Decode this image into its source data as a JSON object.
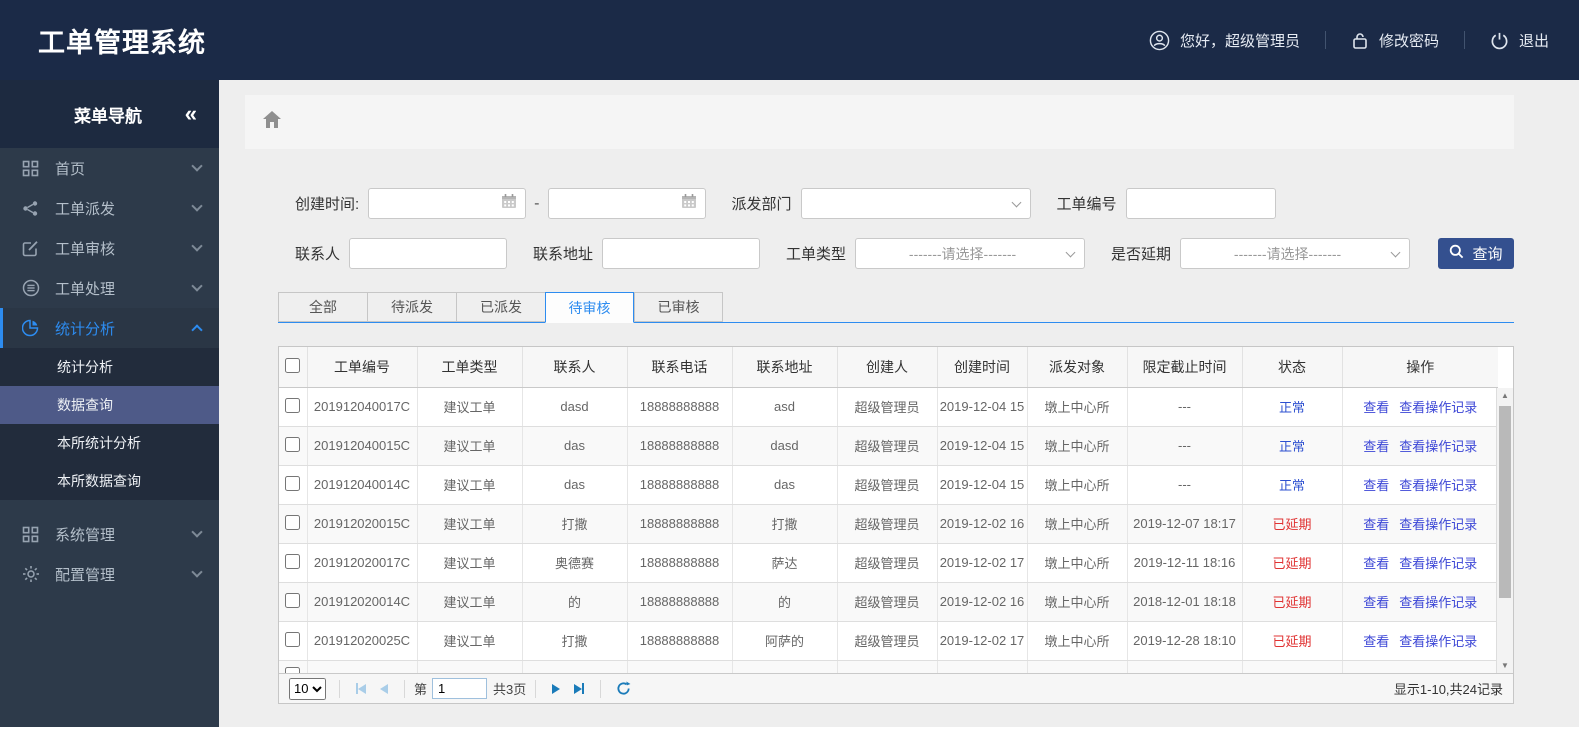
{
  "header": {
    "title": "工单管理系统",
    "greeting": "您好，超级管理员",
    "change_password": "修改密码",
    "logout": "退出"
  },
  "sidebar": {
    "title": "菜单导航",
    "collapse_glyph": "«",
    "items": [
      {
        "label": "首页"
      },
      {
        "label": "工单派发"
      },
      {
        "label": "工单审核"
      },
      {
        "label": "工单处理"
      },
      {
        "label": "统计分析"
      },
      {
        "label": "系统管理"
      },
      {
        "label": "配置管理"
      }
    ],
    "submenu": [
      {
        "label": "统计分析"
      },
      {
        "label": "数据查询"
      },
      {
        "label": "本所统计分析"
      },
      {
        "label": "本所数据查询"
      }
    ],
    "selected_submenu": "数据查询"
  },
  "filters": {
    "create_time_label": "创建时间:",
    "range_separator": "-",
    "department_label": "派发部门",
    "order_no_label": "工单编号",
    "contact_label": "联系人",
    "address_label": "联系地址",
    "type_label": "工单类型",
    "type_placeholder": "-------请选择-------",
    "delay_label": "是否延期",
    "delay_placeholder": "-------请选择-------",
    "search_button_label": "查询"
  },
  "tabs": [
    {
      "label": "全部"
    },
    {
      "label": "待派发"
    },
    {
      "label": "已派发"
    },
    {
      "label": "待审核",
      "active": true
    },
    {
      "label": "已审核"
    }
  ],
  "table": {
    "columns": [
      "工单编号",
      "工单类型",
      "联系人",
      "联系电话",
      "联系地址",
      "创建人",
      "创建时间",
      "派发对象",
      "限定截止时间",
      "状态",
      "操作"
    ],
    "view_label": "查看",
    "view_log_label": "查看操作记录",
    "rows": [
      {
        "order_no": "201912040017C",
        "type": "建议工单",
        "contact": "dasd",
        "phone": "18888888888",
        "address": "asd",
        "creator": "超级管理员",
        "create_time": "2019-12-04 15",
        "target": "墩上中心所",
        "deadline": "---",
        "status": "正常",
        "status_type": "normal"
      },
      {
        "order_no": "201912040015C",
        "type": "建议工单",
        "contact": "das",
        "phone": "18888888888",
        "address": "dasd",
        "creator": "超级管理员",
        "create_time": "2019-12-04 15",
        "target": "墩上中心所",
        "deadline": "---",
        "status": "正常",
        "status_type": "normal"
      },
      {
        "order_no": "201912040014C",
        "type": "建议工单",
        "contact": "das",
        "phone": "18888888888",
        "address": "das",
        "creator": "超级管理员",
        "create_time": "2019-12-04 15",
        "target": "墩上中心所",
        "deadline": "---",
        "status": "正常",
        "status_type": "normal"
      },
      {
        "order_no": "201912020015C",
        "type": "建议工单",
        "contact": "打撒",
        "phone": "18888888888",
        "address": "打撒",
        "creator": "超级管理员",
        "create_time": "2019-12-02 16",
        "target": "墩上中心所",
        "deadline": "2019-12-07 18:17",
        "status": "已延期",
        "status_type": "delayed"
      },
      {
        "order_no": "201912020017C",
        "type": "建议工单",
        "contact": "奥德赛",
        "phone": "18888888888",
        "address": "萨达",
        "creator": "超级管理员",
        "create_time": "2019-12-02 17",
        "target": "墩上中心所",
        "deadline": "2019-12-11 18:16",
        "status": "已延期",
        "status_type": "delayed"
      },
      {
        "order_no": "201912020014C",
        "type": "建议工单",
        "contact": "的",
        "phone": "18888888888",
        "address": "的",
        "creator": "超级管理员",
        "create_time": "2019-12-02 16",
        "target": "墩上中心所",
        "deadline": "2018-12-01 18:18",
        "status": "已延期",
        "status_type": "delayed"
      },
      {
        "order_no": "201912020025C",
        "type": "建议工单",
        "contact": "打撒",
        "phone": "18888888888",
        "address": "阿萨的",
        "creator": "超级管理员",
        "create_time": "2019-12-02 17",
        "target": "墩上中心所",
        "deadline": "2019-12-28 18:10",
        "status": "已延期",
        "status_type": "delayed"
      }
    ]
  },
  "pagination": {
    "page_size": "10",
    "page_label_prefix": "第",
    "current_page": "1",
    "total_pages_label": "共3页",
    "records_summary": "显示1-10,共24记录"
  },
  "colors": {
    "header_navy": "#1b2a47",
    "accent_blue": "#2d8cf0",
    "link_blue": "#3c46d6",
    "status_normal_blue": "#2d50d0",
    "status_delayed_red": "#e03333",
    "query_button_blue": "#34508f",
    "pager_icon_blue": "#1a7bb9",
    "sidebar_selected_bg": "#4e5a88"
  }
}
